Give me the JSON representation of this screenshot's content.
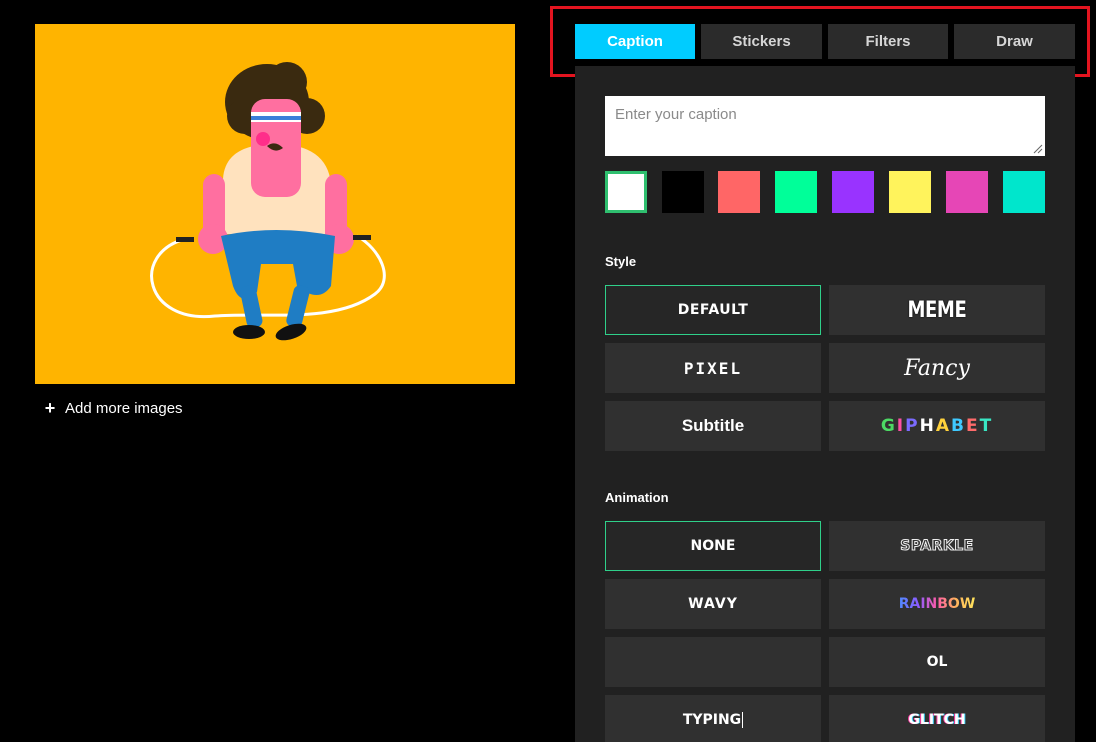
{
  "tabs": [
    {
      "label": "Caption",
      "active": true
    },
    {
      "label": "Stickers",
      "active": false
    },
    {
      "label": "Filters",
      "active": false
    },
    {
      "label": "Draw",
      "active": false
    }
  ],
  "preview": {
    "background": "#ffb400",
    "add_more_label": "Add more images",
    "add_more_icon": "plus-icon"
  },
  "caption": {
    "placeholder": "Enter your caption",
    "value": ""
  },
  "colors": [
    {
      "hex": "#ffffff",
      "selected": true
    },
    {
      "hex": "#000000",
      "selected": false
    },
    {
      "hex": "#ff6666",
      "selected": false
    },
    {
      "hex": "#00ff99",
      "selected": false
    },
    {
      "hex": "#9933ff",
      "selected": false
    },
    {
      "hex": "#fff35c",
      "selected": false
    },
    {
      "hex": "#e646b6",
      "selected": false
    },
    {
      "hex": "#00e6cc",
      "selected": false
    }
  ],
  "style": {
    "label": "Style",
    "options": [
      {
        "label": "DEFAULT",
        "selected": true
      },
      {
        "label": "MEME",
        "selected": false
      },
      {
        "label": "PIXEL",
        "selected": false
      },
      {
        "label": "Fancy",
        "selected": false
      },
      {
        "label": "Subtitle",
        "selected": false
      },
      {
        "label": "GIPHABET",
        "selected": false
      }
    ]
  },
  "animation": {
    "label": "Animation",
    "options": [
      {
        "label": "NONE",
        "selected": true
      },
      {
        "label": "SPARKLE",
        "selected": false
      },
      {
        "label": "WAVY",
        "selected": false
      },
      {
        "label": "RAINBOW",
        "selected": false
      },
      {
        "label": "",
        "selected": false
      },
      {
        "label": "OL",
        "selected": false
      },
      {
        "label": "TYPING",
        "selected": false
      },
      {
        "label": "GLITCH",
        "selected": false
      }
    ]
  },
  "accent_colors": {
    "active_tab": "#00ccff",
    "selected_border": "#2fd08a",
    "highlight_box": "#e3141f"
  }
}
